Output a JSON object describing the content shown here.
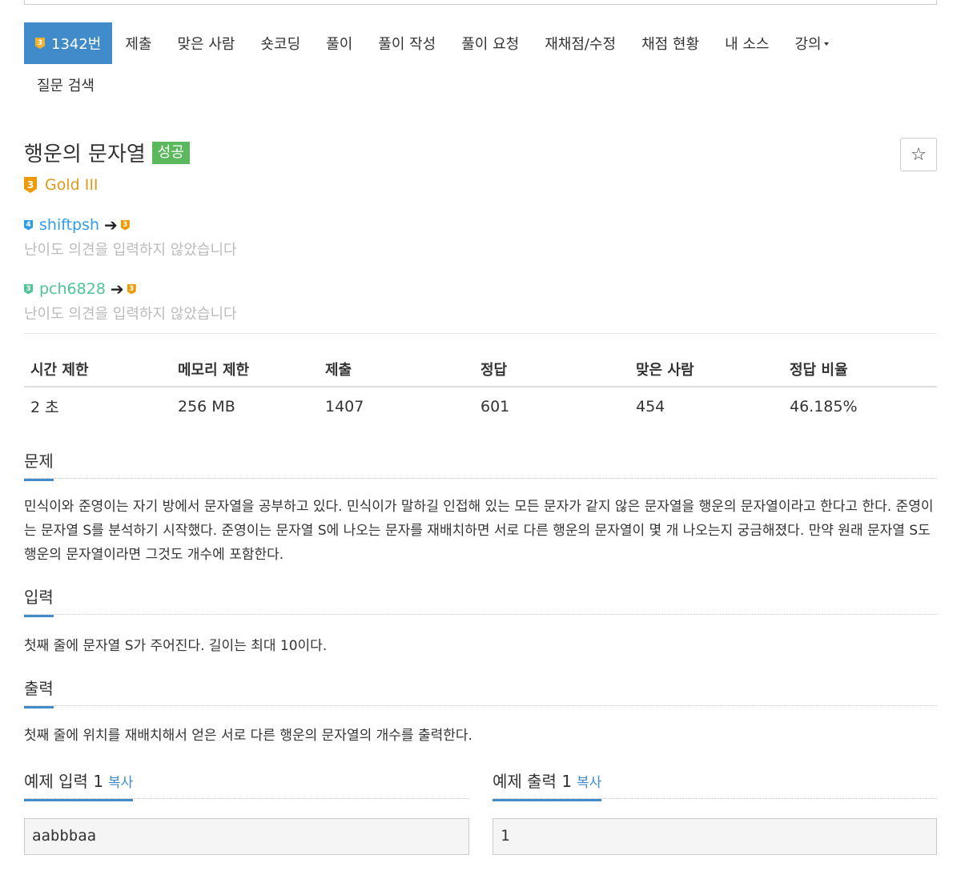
{
  "nav": {
    "problem_badge_tier": "3",
    "items": [
      {
        "label": "1342번",
        "active": true
      },
      {
        "label": "제출"
      },
      {
        "label": "맞은 사람"
      },
      {
        "label": "숏코딩"
      },
      {
        "label": "풀이"
      },
      {
        "label": "풀이 작성"
      },
      {
        "label": "풀이 요청"
      },
      {
        "label": "재채점/수정"
      },
      {
        "label": "채점 현황"
      },
      {
        "label": "내 소스"
      },
      {
        "label": "강의"
      },
      {
        "label": "질문 검색"
      }
    ]
  },
  "problem": {
    "title": "행운의 문자열",
    "result": "성공",
    "tier_icon": "3",
    "tier": "Gold III",
    "star": "☆"
  },
  "opinions": [
    {
      "user": "shiftpsh",
      "user_tier": "4",
      "arrow": "➔",
      "voted_tier": "3",
      "note": "난이도 의견을 입력하지 않았습니다"
    },
    {
      "user": "pch6828",
      "user_tier": "3",
      "arrow": "➔",
      "voted_tier": "3",
      "note": "난이도 의견을 입력하지 않았습니다"
    }
  ],
  "stats": {
    "headers": [
      "시간 제한",
      "메모리 제한",
      "제출",
      "정답",
      "맞은 사람",
      "정답 비율"
    ],
    "values": [
      "2 초",
      "256 MB",
      "1407",
      "601",
      "454",
      "46.185%"
    ]
  },
  "sections": {
    "problem_title": "문제",
    "problem_text": "민식이와 준영이는 자기 방에서 문자열을 공부하고 있다. 민식이가 말하길 인접해 있는 모든 문자가 같지 않은 문자열을 행운의 문자열이라고 한다고 한다. 준영이는 문자열 S를 분석하기 시작했다. 준영이는 문자열 S에 나오는 문자를 재배치하면 서로 다른 행운의 문자열이 몇 개 나오는지 궁금해졌다. 만약 원래 문자열 S도 행운의 문자열이라면 그것도 개수에 포함한다.",
    "input_title": "입력",
    "input_text": "첫째 줄에 문자열 S가 주어진다. 길이는 최대 10이다.",
    "output_title": "출력",
    "output_text": "첫째 줄에 위치를 재배치해서 얻은 서로 다른 행운의 문자열의 개수를 출력한다."
  },
  "samples": {
    "input_title": "예제 입력 1",
    "output_title": "예제 출력 1",
    "copy_label": "복사",
    "input_value": "aabbbaa",
    "output_value": "1"
  }
}
